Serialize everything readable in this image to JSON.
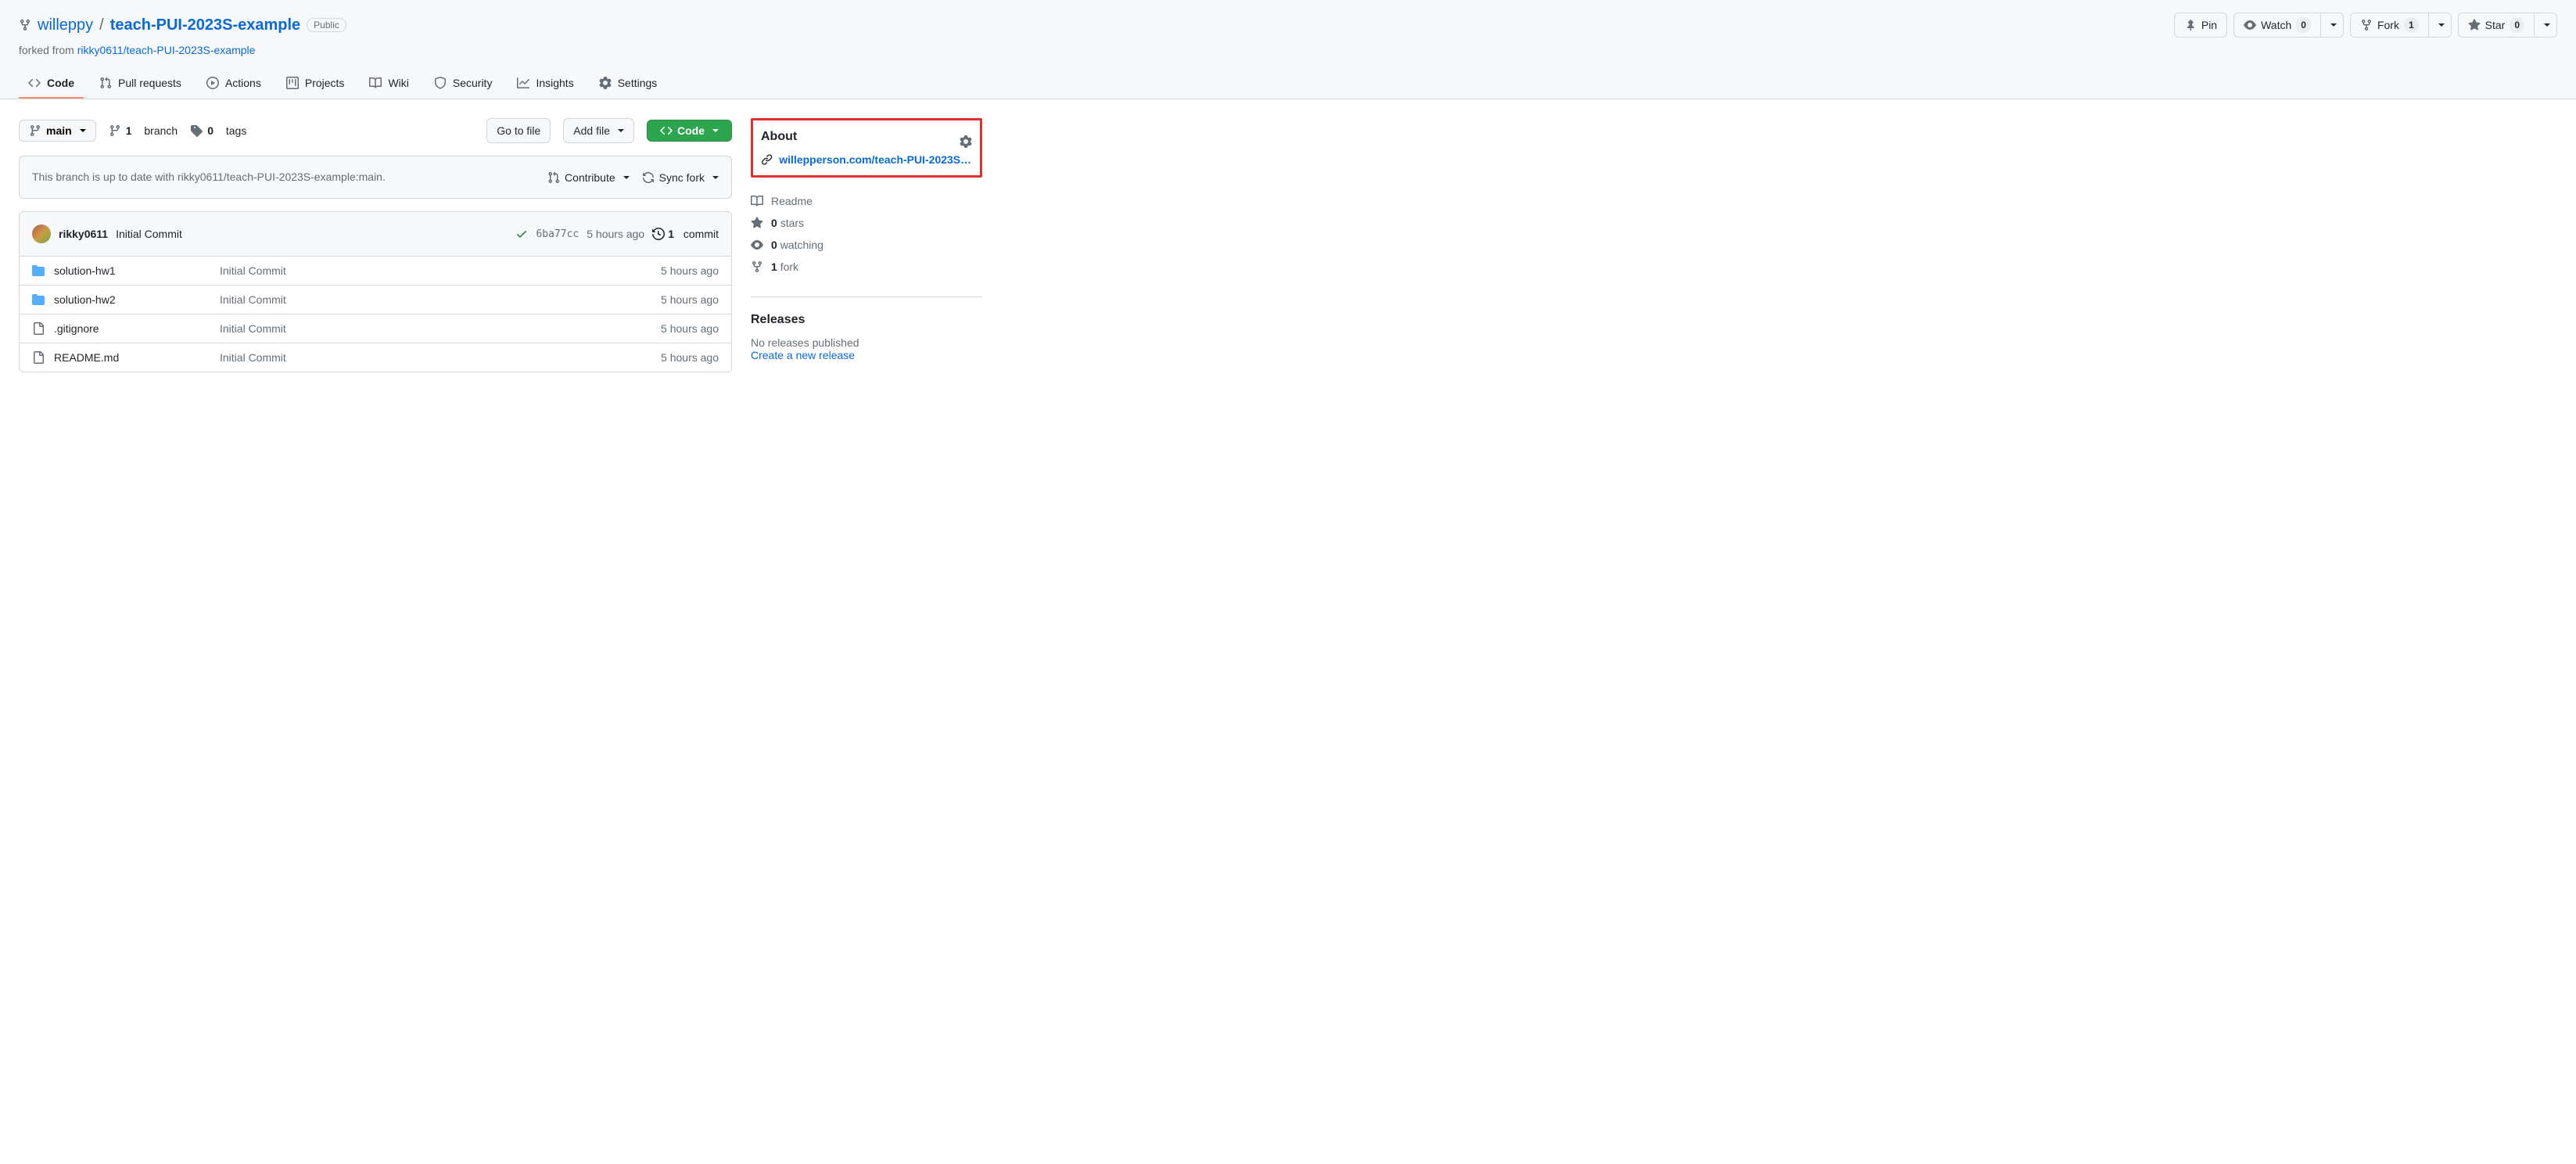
{
  "repo": {
    "owner": "willeppy",
    "name": "teach-PUI-2023S-example",
    "visibility": "Public",
    "forked_from_prefix": "forked from ",
    "forked_from": "rikky0611/teach-PUI-2023S-example"
  },
  "actions": {
    "pin": "Pin",
    "watch": {
      "label": "Watch",
      "count": "0"
    },
    "fork": {
      "label": "Fork",
      "count": "1"
    },
    "star": {
      "label": "Star",
      "count": "0"
    }
  },
  "tabs": {
    "code": "Code",
    "pulls": "Pull requests",
    "actions": "Actions",
    "projects": "Projects",
    "wiki": "Wiki",
    "security": "Security",
    "insights": "Insights",
    "settings": "Settings"
  },
  "file_nav": {
    "branch": "main",
    "branches": {
      "count": "1",
      "label": "branch"
    },
    "tags": {
      "count": "0",
      "label": "tags"
    },
    "go_to_file": "Go to file",
    "add_file": "Add file",
    "code": "Code"
  },
  "branch_status": {
    "message": "This branch is up to date with rikky0611/teach-PUI-2023S-example:main.",
    "contribute": "Contribute",
    "sync": "Sync fork"
  },
  "latest_commit": {
    "author": "rikky0611",
    "message": "Initial Commit",
    "sha": "6ba77cc",
    "time": "5 hours ago",
    "commits_count": "1",
    "commits_label": "commit"
  },
  "files": [
    {
      "type": "dir",
      "name": "solution-hw1",
      "msg": "Initial Commit",
      "time": "5 hours ago"
    },
    {
      "type": "dir",
      "name": "solution-hw2",
      "msg": "Initial Commit",
      "time": "5 hours ago"
    },
    {
      "type": "file",
      "name": ".gitignore",
      "msg": "Initial Commit",
      "time": "5 hours ago"
    },
    {
      "type": "file",
      "name": "README.md",
      "msg": "Initial Commit",
      "time": "5 hours ago"
    }
  ],
  "about": {
    "title": "About",
    "link": "willepperson.com/teach-PUI-2023S-e…",
    "readme": "Readme",
    "stars": {
      "count": "0",
      "label": "stars"
    },
    "watching": {
      "count": "0",
      "label": "watching"
    },
    "forks": {
      "count": "1",
      "label": "fork"
    }
  },
  "releases": {
    "title": "Releases",
    "none": "No releases published",
    "create": "Create a new release"
  }
}
